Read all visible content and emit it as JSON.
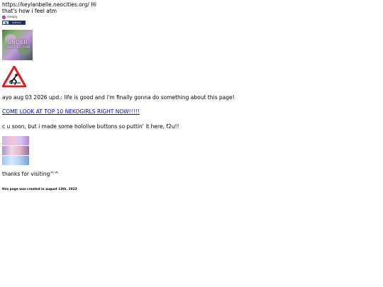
{
  "header": {
    "url_line": "https://keylanbelle.neocities.org/ Hi",
    "subline": "that's how i feel atm"
  },
  "status": {
    "label": "sleepy",
    "badge_text": "status"
  },
  "under_construction": {
    "line1": "UNDER",
    "line2": "CONSTRUCTION"
  },
  "update_text": "ayo aug 03 2026 upd.: life is good and i'm finally gonna do something about this page!",
  "nekogirls_link": "COME LOOK AT TOP 10 NEKOGIRLS RIGHT NOW!!!!!",
  "buttons_intro": "c u soon, but i made some hololive buttons so puttin' it here, f2u!!",
  "thanks_text": "thanks for visiting^^",
  "footer_text": "this page was created in august 13th, 2023",
  "colors": {
    "link": "#0000ee",
    "status_dot": "#b54fd0",
    "badge_dark": "#202a6e",
    "warning_red": "#e21c1c"
  },
  "icons": [
    "status-dot-icon",
    "status-badge-icon",
    "warning-sign-icon"
  ]
}
